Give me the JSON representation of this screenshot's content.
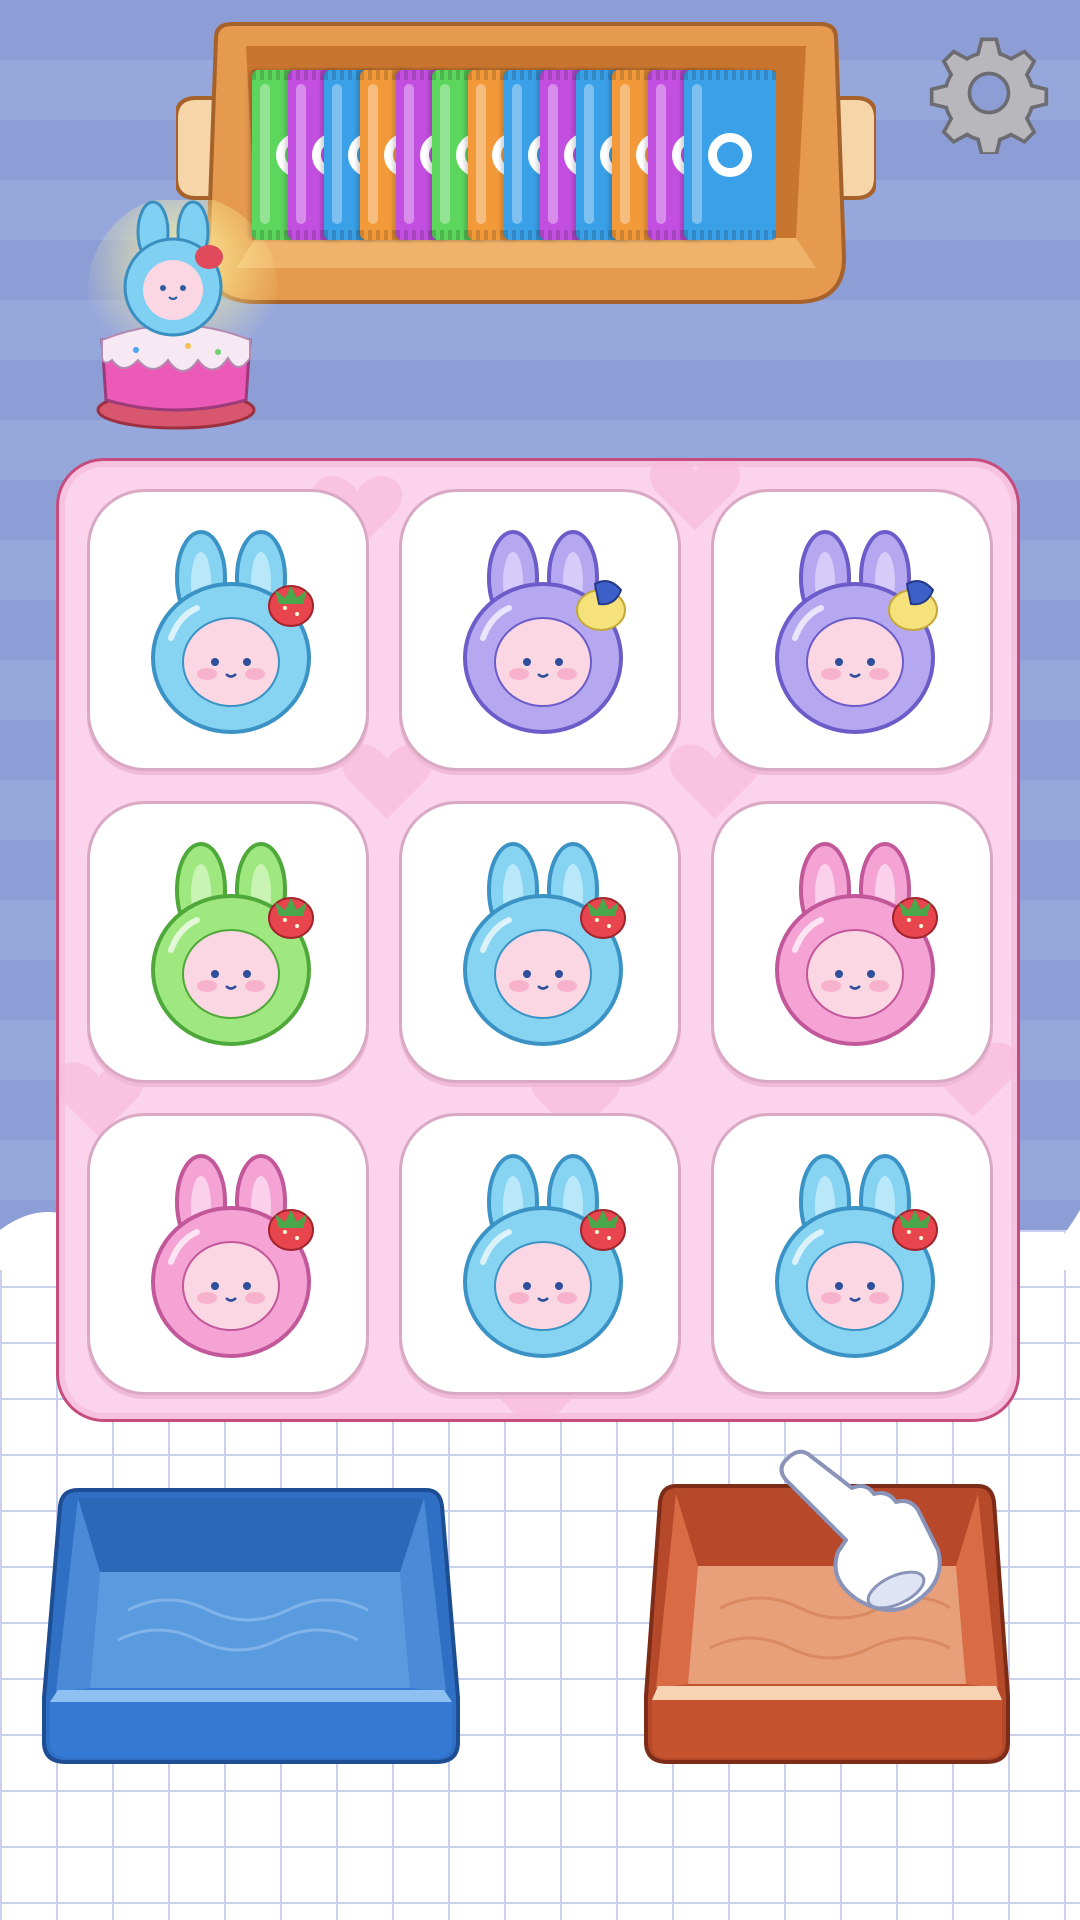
{
  "colors": {
    "background": "#8d9ed6",
    "board": "#fbd3ea",
    "board_border": "#c54c7c",
    "blue_box": "#4b8fdd",
    "orange_box": "#e07a52"
  },
  "settings": {
    "icon": "gear-icon"
  },
  "packet_tray": {
    "packets": [
      {
        "color": "#5cd65c"
      },
      {
        "color": "#c34fe0"
      },
      {
        "color": "#3aa0e8"
      },
      {
        "color": "#f29a3a"
      },
      {
        "color": "#c34fe0"
      },
      {
        "color": "#5cd65c"
      },
      {
        "color": "#f29a3a"
      },
      {
        "color": "#3aa0e8"
      },
      {
        "color": "#c34fe0"
      },
      {
        "color": "#3aa0e8"
      },
      {
        "color": "#f29a3a"
      },
      {
        "color": "#c34fe0"
      },
      {
        "color": "#3aa0e8"
      }
    ]
  },
  "cake_goal": {
    "icon": "bunny-cake-icon",
    "bunny_color": "blue"
  },
  "board": {
    "tiles": [
      {
        "color": "blue",
        "topping": "strawberry"
      },
      {
        "color": "purple",
        "topping": "lemon"
      },
      {
        "color": "purple",
        "topping": "lemon"
      },
      {
        "color": "green",
        "topping": "strawberry"
      },
      {
        "color": "blue",
        "topping": "strawberry"
      },
      {
        "color": "pink",
        "topping": "strawberry"
      },
      {
        "color": "pink",
        "topping": "strawberry"
      },
      {
        "color": "blue",
        "topping": "strawberry"
      },
      {
        "color": "blue",
        "topping": "strawberry"
      }
    ]
  },
  "boxes": [
    {
      "name": "blue-box",
      "color": "#4b8fdd"
    },
    {
      "name": "orange-box",
      "color": "#e07a52"
    }
  ],
  "hint": {
    "icon": "pointing-hand-icon"
  }
}
